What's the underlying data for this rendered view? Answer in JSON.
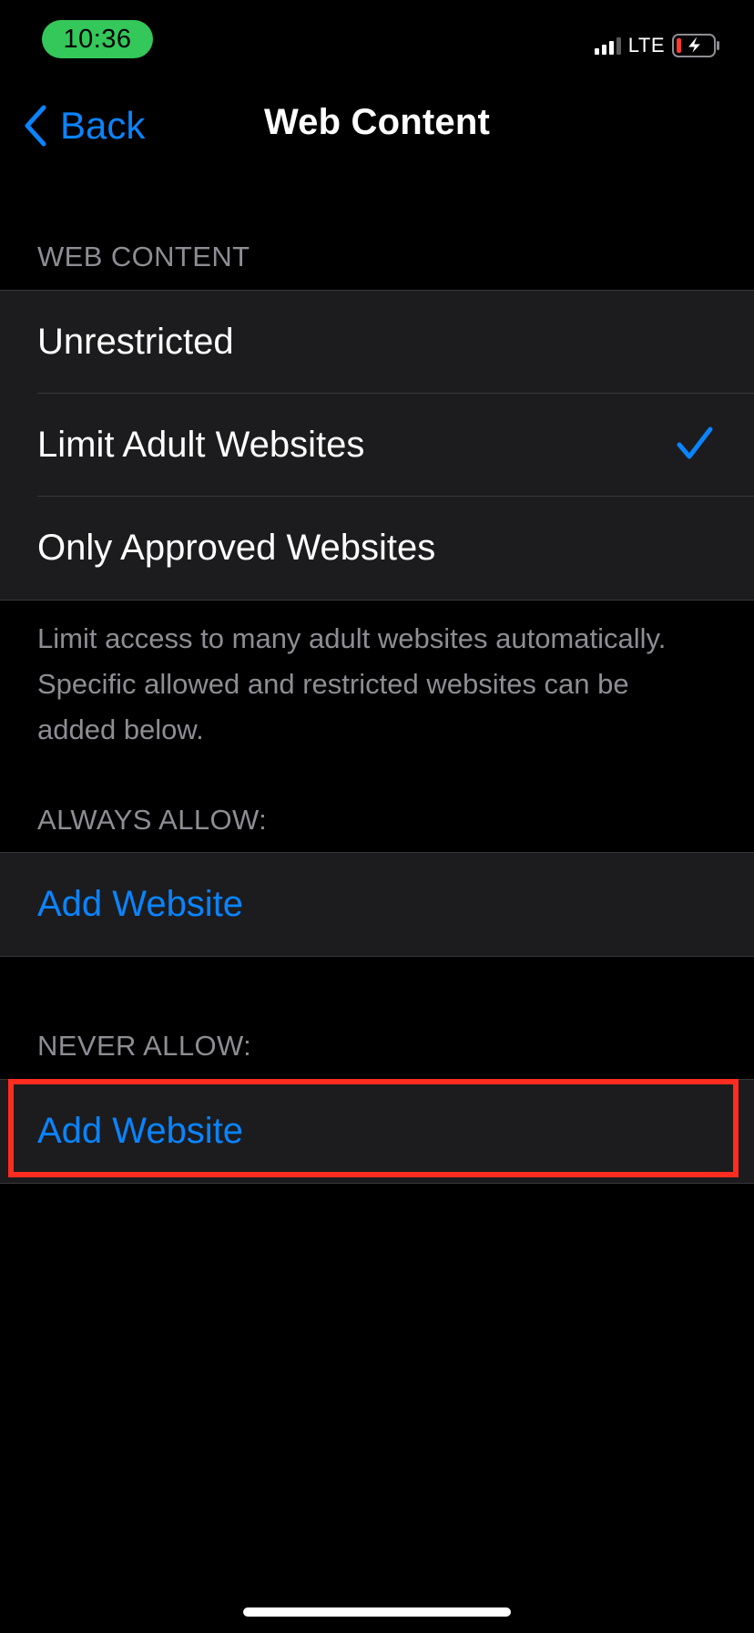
{
  "status_bar": {
    "time": "10:36",
    "network": "LTE",
    "time_pill_color": "#34c759",
    "battery_level": 0.1,
    "battery_charging": true
  },
  "nav": {
    "back_label": "Back",
    "title": "Web Content"
  },
  "web_content": {
    "header": "WEB CONTENT",
    "options": [
      {
        "label": "Unrestricted",
        "selected": false
      },
      {
        "label": "Limit Adult Websites",
        "selected": true
      },
      {
        "label": "Only Approved Websites",
        "selected": false
      }
    ],
    "footer": "Limit access to many adult websites automatically. Specific allowed and restricted websites can be added below."
  },
  "always_allow": {
    "header": "ALWAYS ALLOW:",
    "add_label": "Add Website"
  },
  "never_allow": {
    "header": "NEVER ALLOW:",
    "add_label": "Add Website",
    "highlighted": true
  },
  "colors": {
    "accent": "#0a84ff",
    "highlight": "#ff2d1f",
    "cell_background": "#1c1c1e",
    "secondary_text": "#8d8d93"
  }
}
